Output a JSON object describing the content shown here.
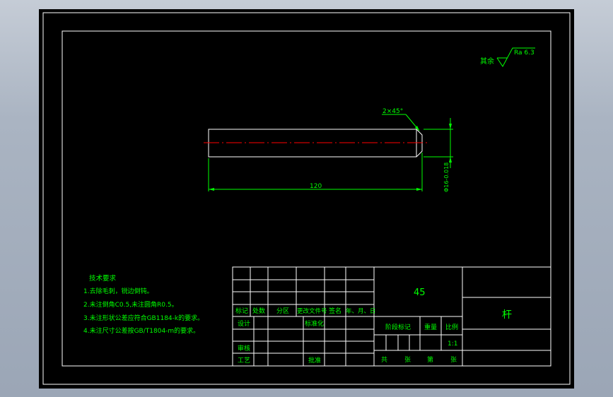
{
  "surface_finish": {
    "prefix": "其余",
    "value": "Ra 6.3"
  },
  "dimensions": {
    "chamfer": "2×45°",
    "length": "120",
    "diameter": "Φ16-0.018"
  },
  "tech_requirements": {
    "title": "技术要求",
    "items": [
      "1.去除毛刺，锐边倒钝。",
      "2.未注倒角C0.5,未注圆角R0.5。",
      "3.未注形状公差应符合GB1184-k的要求。",
      "4.未注尺寸公差按GB/T1804-m的要求。"
    ]
  },
  "title_block": {
    "material": "45",
    "part_name": "杆",
    "scale_value": "1:1",
    "labels": {
      "mark": "标记",
      "count": "处数",
      "zone": "分区",
      "doc_no": "更改文件号",
      "sign": "签名",
      "date": "年、月、日",
      "design": "设计",
      "standardize": "标准化",
      "stage_mark": "阶段标记",
      "weight": "重量",
      "scale": "比例",
      "review": "审核",
      "process": "工艺",
      "approve": "批准",
      "total": "共",
      "sheets": "张",
      "number": "第",
      "sheet": "张"
    }
  },
  "colors": {
    "frame": "#ffffff",
    "dimension": "#00ff00",
    "centerline": "#ff0000",
    "text": "#00ff00",
    "background": "#000000"
  }
}
